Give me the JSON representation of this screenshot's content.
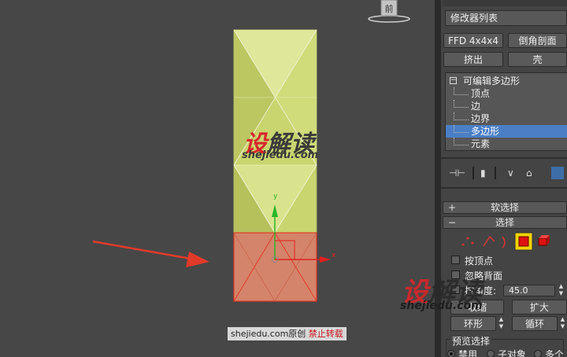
{
  "viewport": {
    "viewcube_label": "前",
    "watermark": {
      "logo_a": "设",
      "logo_b": "解读",
      "url": "shejiedu.com"
    },
    "caption": {
      "site": "shejiedu.com",
      "mid": "原创",
      "notice": "禁止转载"
    },
    "gizmo": {
      "y_label": "y",
      "x_label": "x"
    },
    "colors": {
      "top_segments": "#c8d46f",
      "selected_segment": "#d4846a",
      "selected_edge": "#e23a2a",
      "arrow": "#e23a2a"
    }
  },
  "panel": {
    "modifier_list": "修改器列表",
    "buttons": [
      "FFD 4x4x4",
      "倒角剖面",
      "挤出",
      "壳"
    ],
    "stack": {
      "root": "可编辑多边形",
      "items": [
        "顶点",
        "边",
        "边界",
        "多边形",
        "元素"
      ],
      "selected_index": 3
    },
    "rollouts": {
      "soft_selection": "软选择",
      "selection": "选择"
    },
    "selection": {
      "by_vertex": "按顶点",
      "ignore_backfacing": "忽略背面",
      "angle_label": "按角度:",
      "angle_value": "45.0",
      "shrink": "收缩",
      "grow": "扩大",
      "ring": "环形",
      "loop": "循环",
      "preview_label": "预览选择",
      "preview_options": [
        "禁用",
        "子对象",
        "多个"
      ],
      "preview_selected": 0
    },
    "watermark": {
      "logo_a": "设",
      "logo_b": "解读",
      "url": "shejiedu.com"
    },
    "colors": {
      "selected_row": "#4a7fc6",
      "active_mode": "#f0d400"
    }
  }
}
